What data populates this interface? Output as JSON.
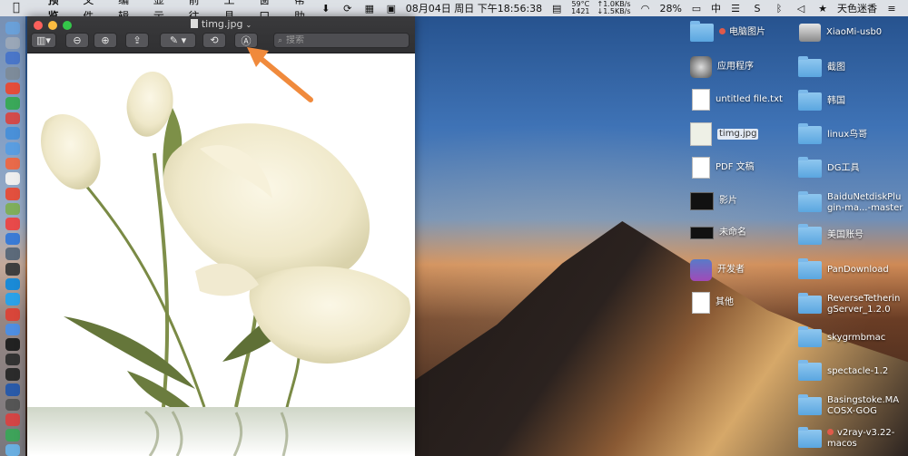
{
  "menubar": {
    "app_name": "预览",
    "items": [
      "文件",
      "编辑",
      "显示",
      "前往",
      "工具",
      "窗口",
      "帮助"
    ],
    "temp": "59°C",
    "cpu": "1421",
    "net_up": "↑1.0KB/s",
    "net_down": "↓1.5KB/s",
    "datetime": "08月04日 周日 下午18:56:38",
    "battery": "28%",
    "input_method": "中",
    "user": "天色迷香"
  },
  "window": {
    "title": "timg.jpg",
    "search_placeholder": "搜索"
  },
  "desktop": {
    "left_column": [
      {
        "label": "电脑图片",
        "kind": "folder",
        "tag": true
      },
      {
        "label": "应用程序",
        "kind": "app"
      },
      {
        "label": "untitled file.txt",
        "kind": "doc"
      },
      {
        "label": "timg.jpg",
        "kind": "image",
        "selected": true
      },
      {
        "label": "PDF 文稿",
        "kind": "doc"
      },
      {
        "label": "影片",
        "kind": "dark"
      },
      {
        "label": "未命名",
        "kind": "dark"
      },
      {
        "label": "开发者",
        "kind": "app"
      },
      {
        "label": "其他",
        "kind": "doc"
      }
    ],
    "right_column": [
      {
        "label": "XiaoMi-usb0",
        "kind": "drive"
      },
      {
        "label": "截图",
        "kind": "folder"
      },
      {
        "label": "韩国",
        "kind": "folder"
      },
      {
        "label": "linux鸟哥",
        "kind": "folder"
      },
      {
        "label": "DG工具",
        "kind": "folder"
      },
      {
        "label": "BaiduNetdiskPlu\ngin-ma...-master",
        "kind": "folder"
      },
      {
        "label": "美国账号",
        "kind": "folder"
      },
      {
        "label": "PanDownload",
        "kind": "folder"
      },
      {
        "label": "ReverseTetherin\ngServer_1.2.0",
        "kind": "folder"
      },
      {
        "label": "skygrmbmac",
        "kind": "folder"
      },
      {
        "label": "spectacle-1.2",
        "kind": "folder"
      },
      {
        "label": "Basingstoke.MA\nCOSX-GOG",
        "kind": "folder"
      },
      {
        "label": "v2ray-v3.22-\nmacos",
        "kind": "folder",
        "tag": true
      }
    ]
  },
  "colors": {
    "accent_arrow": "#f08a3c",
    "toolbar": "#3a3a3c"
  }
}
